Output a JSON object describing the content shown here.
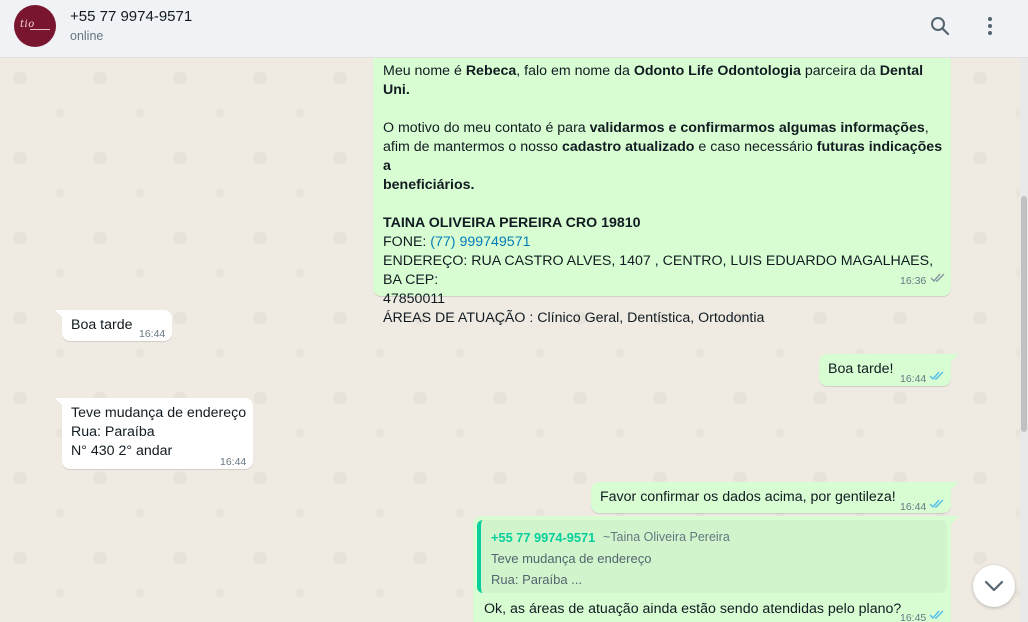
{
  "header": {
    "contact_name": "+55 77 9974-9571",
    "status": "online",
    "icons": [
      "search-icon",
      "menu-icon"
    ]
  },
  "messages": {
    "m1": {
      "direction": "outgoing",
      "p1_a": "Meu nome é ",
      "p1_b": "Rebeca",
      "p1_c": ", falo em nome da ",
      "p1_d": "Odonto Life Odontologia",
      "p1_e": " parceira da ",
      "p1_f": "Dental",
      "p1_g": "Uni.",
      "p2_a": "O motivo do meu contato é para ",
      "p2_b": "validarmos e confirmarmos algumas informações",
      "p2_c": ",",
      "p2_d": "afim de mantermos o nosso ",
      "p2_e": "cadastro atualizado",
      "p2_f": " e caso necessário ",
      "p2_g": "futuras indicações a",
      "p2_h": "beneficiários.",
      "p3_title": "TAINA OLIVEIRA PEREIRA CRO 19810",
      "p3_fone_label": "FONE: ",
      "p3_fone": "(77) 999749571",
      "p3_end_1": "ENDEREÇO: RUA CASTRO ALVES, 1407 , CENTRO, LUIS EDUARDO MAGALHAES, BA CEP:",
      "p3_end_2": "47850011",
      "p3_areas": "ÁREAS DE ATUAÇÃO : Clínico Geral, Dentística, Ortodontia",
      "time": "16:36"
    },
    "m2": {
      "direction": "incoming",
      "text": "Boa tarde",
      "time": "16:44"
    },
    "m3": {
      "direction": "outgoing",
      "text": "Boa tarde!",
      "time": "16:44"
    },
    "m4": {
      "direction": "incoming",
      "line1": "Teve mudança de endereço",
      "line2": "Rua: Paraíba",
      "line3": "N° 430 2° andar",
      "time": "16:44"
    },
    "m5": {
      "direction": "outgoing",
      "text": "Favor confirmar os dados acima, por gentileza!",
      "time": "16:44"
    },
    "m6": {
      "direction": "outgoing",
      "quote_author": "+55 77 9974-9571",
      "quote_name": "~Taina Oliveira Pereira",
      "quote_line1": "Teve mudança de endereço",
      "quote_line2": "Rua: Paraíba ...",
      "text": "Ok, as áreas de atuação ainda estão sendo atendidas pelo plano?",
      "time": "16:45"
    }
  },
  "colors": {
    "outgoing_bubble": "#d9fdd3",
    "incoming_bubble": "#ffffff",
    "chat_background": "#efeae2",
    "read_ticks": "#53bdeb",
    "quote_accent": "#06cf9c",
    "avatar": "#7a1530"
  }
}
